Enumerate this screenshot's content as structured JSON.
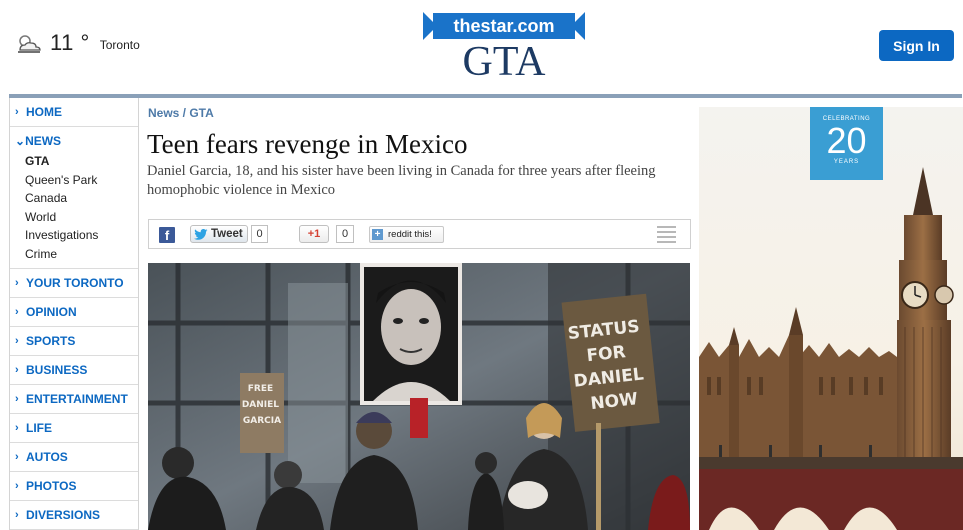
{
  "weather": {
    "temp": "11 °",
    "city": "Toronto",
    "icon": "partly-cloudy-icon"
  },
  "header": {
    "logo_text": "thestar.com",
    "section": "GTA",
    "signin_label": "Sign In"
  },
  "colors": {
    "link_blue": "#0c68c2",
    "section_navy": "#1d3a63",
    "rule": "#8aa0b8"
  },
  "nav": {
    "items_top": [
      {
        "label": "HOME"
      }
    ],
    "open": {
      "label": "NEWS",
      "children": [
        "GTA",
        "Queen's Park",
        "Canada",
        "World",
        "Investigations",
        "Crime"
      ],
      "active": "GTA"
    },
    "items_bottom": [
      {
        "label": "YOUR TORONTO"
      },
      {
        "label": "OPINION"
      },
      {
        "label": "SPORTS"
      },
      {
        "label": "BUSINESS"
      },
      {
        "label": "ENTERTAINMENT"
      },
      {
        "label": "LIFE"
      },
      {
        "label": "AUTOS"
      },
      {
        "label": "PHOTOS"
      },
      {
        "label": "DIVERSIONS"
      }
    ]
  },
  "article": {
    "breadcrumb": "News / GTA",
    "headline": "Teen fears revenge in Mexico",
    "deck": "Daniel Garcia, 18, and his sister have been living in Canada for three years after fleeing homophobic violence in Mexico"
  },
  "share": {
    "facebook_icon": "f",
    "tweet_label": "Tweet",
    "tweet_count": "0",
    "gplus_label": "+1",
    "gplus_count": "0",
    "reddit_label": "reddit this!",
    "reddit_icon": "+"
  },
  "photo": {
    "sign_free": "FREE DANIEL GARCIA",
    "sign_status": "STATUS FOR DANIEL NOW"
  },
  "ad": {
    "badge_top": "CELEBRATING",
    "badge_number": "20",
    "badge_bottom": "YEARS"
  }
}
